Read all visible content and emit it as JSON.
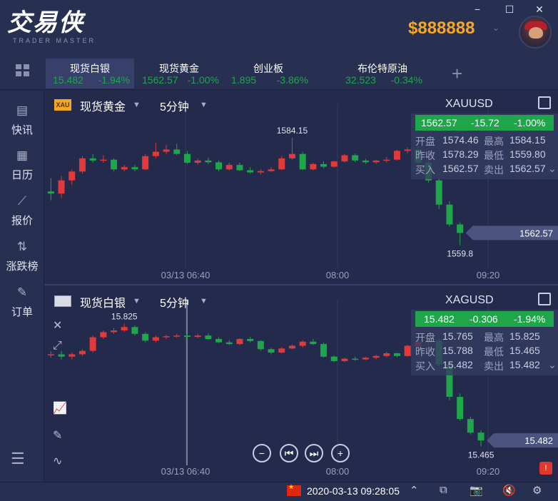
{
  "app": {
    "logo_text": "交易侠",
    "logo_sub": "TRADER MASTER",
    "balance": "$888888"
  },
  "colors": {
    "up": "#e03a3a",
    "down": "#1fa64a",
    "accent": "#f5a623"
  },
  "tabs": [
    {
      "name": "现货白银",
      "price": "15.482",
      "change": "-1.94%",
      "active": true
    },
    {
      "name": "现货黄金",
      "price": "1562.57",
      "change": "-1.00%",
      "active": false
    },
    {
      "name": "创业板",
      "price": "1.895",
      "change": "-3.86%",
      "active": false
    },
    {
      "name": "布伦特原油",
      "price": "32.523",
      "change": "-0.34%",
      "active": false
    }
  ],
  "sidebar": [
    {
      "label": "快讯",
      "icon": "news-icon"
    },
    {
      "label": "日历",
      "icon": "calendar-icon"
    },
    {
      "label": "报价",
      "icon": "quote-icon"
    },
    {
      "label": "涨跌榜",
      "icon": "ranking-icon"
    },
    {
      "label": "订单",
      "icon": "order-icon"
    }
  ],
  "panel1": {
    "badge": "XAU",
    "name": "现货黄金",
    "period": "5分钟",
    "code": "XAUUSD",
    "price": "1562.57",
    "chg": "-15.72",
    "pct": "-1.00%",
    "open_label": "开盘",
    "open": "1574.46",
    "high_label": "最高",
    "high": "1584.15",
    "prev_label": "昨收",
    "prev": "1578.29",
    "low_label": "最低",
    "low": "1559.80",
    "bid_label": "买入",
    "bid": "1562.57",
    "ask_label": "卖出",
    "ask": "1562.57"
  },
  "panel2": {
    "name": "现货白银",
    "period": "5分钟",
    "code": "XAGUSD",
    "price": "15.482",
    "chg": "-0.306",
    "pct": "-1.94%",
    "open_label": "开盘",
    "open": "15.765",
    "high_label": "最高",
    "high": "15.825",
    "prev_label": "昨收",
    "prev": "15.788",
    "low_label": "最低",
    "low": "15.465",
    "bid_label": "买入",
    "bid": "15.482",
    "ask_label": "卖出",
    "ask": "15.482"
  },
  "status": {
    "datetime": "2020-03-13 09:28:05"
  },
  "chart_data": [
    {
      "type": "candlestick",
      "title": "XAUUSD",
      "x_ticks": [
        "03/13 06:40",
        "08:00",
        "09:20"
      ],
      "annotations": {
        "high": "1584.15",
        "low": "1559.8",
        "last": "1562.57"
      },
      "ylim": [
        1556,
        1590
      ],
      "candles": [
        [
          1572.0,
          1575.0,
          1570.0,
          1571.5
        ],
        [
          1571.5,
          1575.5,
          1570.5,
          1574.5
        ],
        [
          1574.5,
          1577.0,
          1573.5,
          1576.5
        ],
        [
          1576.5,
          1580.0,
          1576.0,
          1579.5
        ],
        [
          1579.5,
          1580.5,
          1578.5,
          1579.0
        ],
        [
          1579.0,
          1580.2,
          1578.5,
          1579.2
        ],
        [
          1579.2,
          1579.5,
          1576.5,
          1577.0
        ],
        [
          1577.0,
          1578.0,
          1576.5,
          1577.5
        ],
        [
          1577.5,
          1578.0,
          1576.5,
          1577.0
        ],
        [
          1577.0,
          1580.5,
          1576.8,
          1580.0
        ],
        [
          1580.0,
          1583.0,
          1579.5,
          1581.0
        ],
        [
          1581.0,
          1582.5,
          1580.5,
          1581.5
        ],
        [
          1581.5,
          1582.8,
          1580.2,
          1580.5
        ],
        [
          1580.5,
          1581.2,
          1578.2,
          1578.5
        ],
        [
          1578.5,
          1579.5,
          1578.0,
          1579.0
        ],
        [
          1579.0,
          1579.6,
          1578.2,
          1578.6
        ],
        [
          1578.6,
          1579.0,
          1576.5,
          1577.0
        ],
        [
          1577.0,
          1578.5,
          1576.8,
          1578.0
        ],
        [
          1578.0,
          1578.5,
          1576.6,
          1576.8
        ],
        [
          1576.8,
          1577.5,
          1576.0,
          1576.3
        ],
        [
          1576.3,
          1577.0,
          1575.8,
          1576.6
        ],
        [
          1576.6,
          1577.5,
          1576.4,
          1577.0
        ],
        [
          1577.0,
          1580.0,
          1576.8,
          1579.5
        ],
        [
          1579.5,
          1584.15,
          1579.2,
          1580.5
        ],
        [
          1580.5,
          1581.0,
          1576.8,
          1577.0
        ],
        [
          1577.0,
          1578.5,
          1576.8,
          1578.2
        ],
        [
          1578.2,
          1578.8,
          1577.2,
          1577.6
        ],
        [
          1577.6,
          1579.0,
          1577.4,
          1578.8
        ],
        [
          1578.8,
          1580.5,
          1578.6,
          1580.2
        ],
        [
          1580.2,
          1580.6,
          1578.6,
          1579.0
        ],
        [
          1579.0,
          1579.4,
          1578.2,
          1578.6
        ],
        [
          1578.6,
          1579.2,
          1578.2,
          1579.0
        ],
        [
          1579.0,
          1579.8,
          1578.6,
          1579.2
        ],
        [
          1579.2,
          1581.5,
          1579.0,
          1581.2
        ],
        [
          1581.2,
          1582.0,
          1580.6,
          1581.5
        ],
        [
          1581.5,
          1582.2,
          1578.0,
          1578.5
        ],
        [
          1578.5,
          1579.0,
          1574.0,
          1574.5
        ],
        [
          1574.5,
          1575.0,
          1568.0,
          1569.0
        ],
        [
          1569.0,
          1569.8,
          1564.0,
          1564.5
        ],
        [
          1564.5,
          1565.0,
          1559.8,
          1562.57
        ]
      ]
    },
    {
      "type": "candlestick",
      "title": "XAGUSD",
      "x_ticks": [
        "03/13 06:40",
        "08:00",
        "09:20"
      ],
      "annotations": {
        "high": "15.825",
        "low": "15.465",
        "last": "15.482"
      },
      "ylim": [
        15.43,
        15.87
      ],
      "candles": [
        [
          15.735,
          15.745,
          15.725,
          15.735
        ],
        [
          15.735,
          15.745,
          15.72,
          15.728
        ],
        [
          15.728,
          15.74,
          15.72,
          15.735
        ],
        [
          15.735,
          15.75,
          15.73,
          15.745
        ],
        [
          15.745,
          15.79,
          15.74,
          15.785
        ],
        [
          15.785,
          15.805,
          15.78,
          15.8
        ],
        [
          15.8,
          15.812,
          15.795,
          15.805
        ],
        [
          15.805,
          15.825,
          15.8,
          15.815
        ],
        [
          15.815,
          15.82,
          15.79,
          15.795
        ],
        [
          15.795,
          15.8,
          15.77,
          15.775
        ],
        [
          15.775,
          15.79,
          15.77,
          15.785
        ],
        [
          15.785,
          15.792,
          15.78,
          15.788
        ],
        [
          15.788,
          15.795,
          15.784,
          15.79
        ],
        [
          15.79,
          15.795,
          15.782,
          15.786
        ],
        [
          15.786,
          15.795,
          15.782,
          15.79
        ],
        [
          15.79,
          15.796,
          15.778,
          15.78
        ],
        [
          15.78,
          15.785,
          15.768,
          15.77
        ],
        [
          15.77,
          15.776,
          15.762,
          15.765
        ],
        [
          15.765,
          15.782,
          15.762,
          15.78
        ],
        [
          15.78,
          15.786,
          15.77,
          15.774
        ],
        [
          15.774,
          15.776,
          15.745,
          15.75
        ],
        [
          15.75,
          15.754,
          15.735,
          15.74
        ],
        [
          15.74,
          15.756,
          15.738,
          15.752
        ],
        [
          15.752,
          15.764,
          15.75,
          15.76
        ],
        [
          15.76,
          15.776,
          15.755,
          15.772
        ],
        [
          15.772,
          15.78,
          15.762,
          15.765
        ],
        [
          15.765,
          15.77,
          15.725,
          15.728
        ],
        [
          15.728,
          15.732,
          15.712,
          15.715
        ],
        [
          15.715,
          15.725,
          15.712,
          15.722
        ],
        [
          15.722,
          15.728,
          15.716,
          15.72
        ],
        [
          15.72,
          15.728,
          15.718,
          15.725
        ],
        [
          15.725,
          15.734,
          15.72,
          15.73
        ],
        [
          15.73,
          15.742,
          15.726,
          15.738
        ],
        [
          15.738,
          15.74,
          15.726,
          15.73
        ],
        [
          15.73,
          15.762,
          15.728,
          15.76
        ],
        [
          15.76,
          15.775,
          15.752,
          15.77
        ],
        [
          15.77,
          15.78,
          15.76,
          15.775
        ],
        [
          15.775,
          15.78,
          15.7,
          15.705
        ],
        [
          15.705,
          15.712,
          15.6,
          15.61
        ],
        [
          15.61,
          15.62,
          15.54,
          15.545
        ],
        [
          15.545,
          15.552,
          15.5,
          15.505
        ],
        [
          15.505,
          15.512,
          15.465,
          15.482
        ]
      ]
    }
  ]
}
